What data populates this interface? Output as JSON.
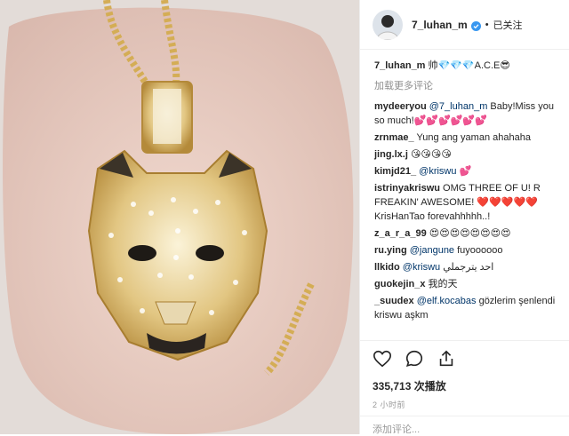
{
  "post": {
    "author": "7_luhan_m",
    "follow_status": "已关注",
    "separator": "•",
    "caption_author": "7_luhan_m",
    "caption_text": "帅💎💎💎A.C.E😎",
    "load_more": "加载更多评论",
    "likes": "335,713 次播放",
    "time": "2 小时前",
    "add_comment_placeholder": "添加评论..."
  },
  "comments": [
    {
      "user": "mydeeryou",
      "mention": "@7_luhan_m",
      "text": " Baby!Miss you so much!💕💕💕💕💕💕"
    },
    {
      "user": "zrnmae_",
      "mention": "",
      "text": "Yung ang yaman ahahaha"
    },
    {
      "user": "jing.lx.j",
      "mention": "",
      "text": "😘😘😘😘"
    },
    {
      "user": "kimjd21_",
      "mention": "@kriswu",
      "text": " 💕"
    },
    {
      "user": "istrinyakriswu",
      "mention": "",
      "text": "OMG THREE OF U! R FREAKIN' AWESOME! ❤️❤️❤️❤️❤️ KrisHanTao forevahhhhh..!"
    },
    {
      "user": "z_a_r_a_99",
      "mention": "",
      "text": "😍😍😍😍😍😍😍😍"
    },
    {
      "user": "ru.ying",
      "mention": "@jangune",
      "text": " fuyoooooo"
    },
    {
      "user": "llkido",
      "mention": "@kriswu",
      "text": " احد يترجملي"
    },
    {
      "user": "guokejin_x",
      "mention": "",
      "text": "我的天"
    },
    {
      "user": "_suudex",
      "mention": "@elf.kocabas",
      "text": " gözlerim şenlendi kriswu aşkm"
    }
  ],
  "icons": [
    "heart-icon",
    "comment-icon",
    "share-icon"
  ],
  "colors": {
    "mention": "#003569",
    "muted": "#8e8e8e",
    "verified": "#3897f0"
  }
}
